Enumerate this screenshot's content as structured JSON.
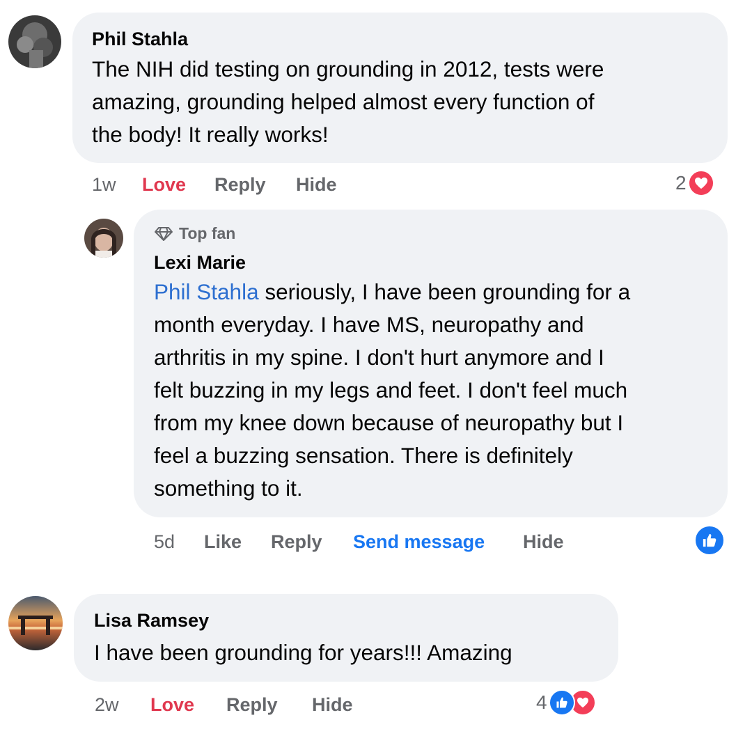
{
  "comments": [
    {
      "author": "Phil Stahla",
      "lines": [
        "The NIH did testing on grounding in 2012, tests were",
        "amazing, grounding helped almost every function of",
        "the body! It really works!"
      ],
      "time": "1w",
      "reacted_label": "Love",
      "reply_label": "Reply",
      "hide_label": "Hide",
      "reaction_count": "2",
      "reaction_icons": [
        "heart-icon"
      ]
    },
    {
      "badge": "Top fan",
      "badge_icon": "diamond-icon",
      "author": "Lexi Marie",
      "mention": "Phil Stahla",
      "first_line_rest": " seriously, I have been grounding for a",
      "lines": [
        "month everyday. I have MS, neuropathy and",
        "arthritis in my spine. I don't hurt anymore and I",
        "felt buzzing in my legs and feet. I don't feel much",
        "from my knee down because of neuropathy but I",
        "feel a buzzing sensation. There is definitely",
        "something to it."
      ],
      "time": "5d",
      "like_label": "Like",
      "reply_label": "Reply",
      "send_label": "Send message",
      "hide_label": "Hide",
      "reaction_icons": [
        "like-icon"
      ]
    },
    {
      "author": "Lisa Ramsey",
      "lines": [
        "I have been grounding for years!!! Amazing"
      ],
      "time": "2w",
      "reacted_label": "Love",
      "reply_label": "Reply",
      "hide_label": "Hide",
      "reaction_count": "4",
      "reaction_icons": [
        "like-icon",
        "heart-icon"
      ]
    }
  ],
  "colors": {
    "bubble": "#f0f2f5",
    "love": "#e0384f",
    "link": "#1877f2",
    "mention": "#2d6fd0",
    "secondary_text": "#65676b"
  }
}
